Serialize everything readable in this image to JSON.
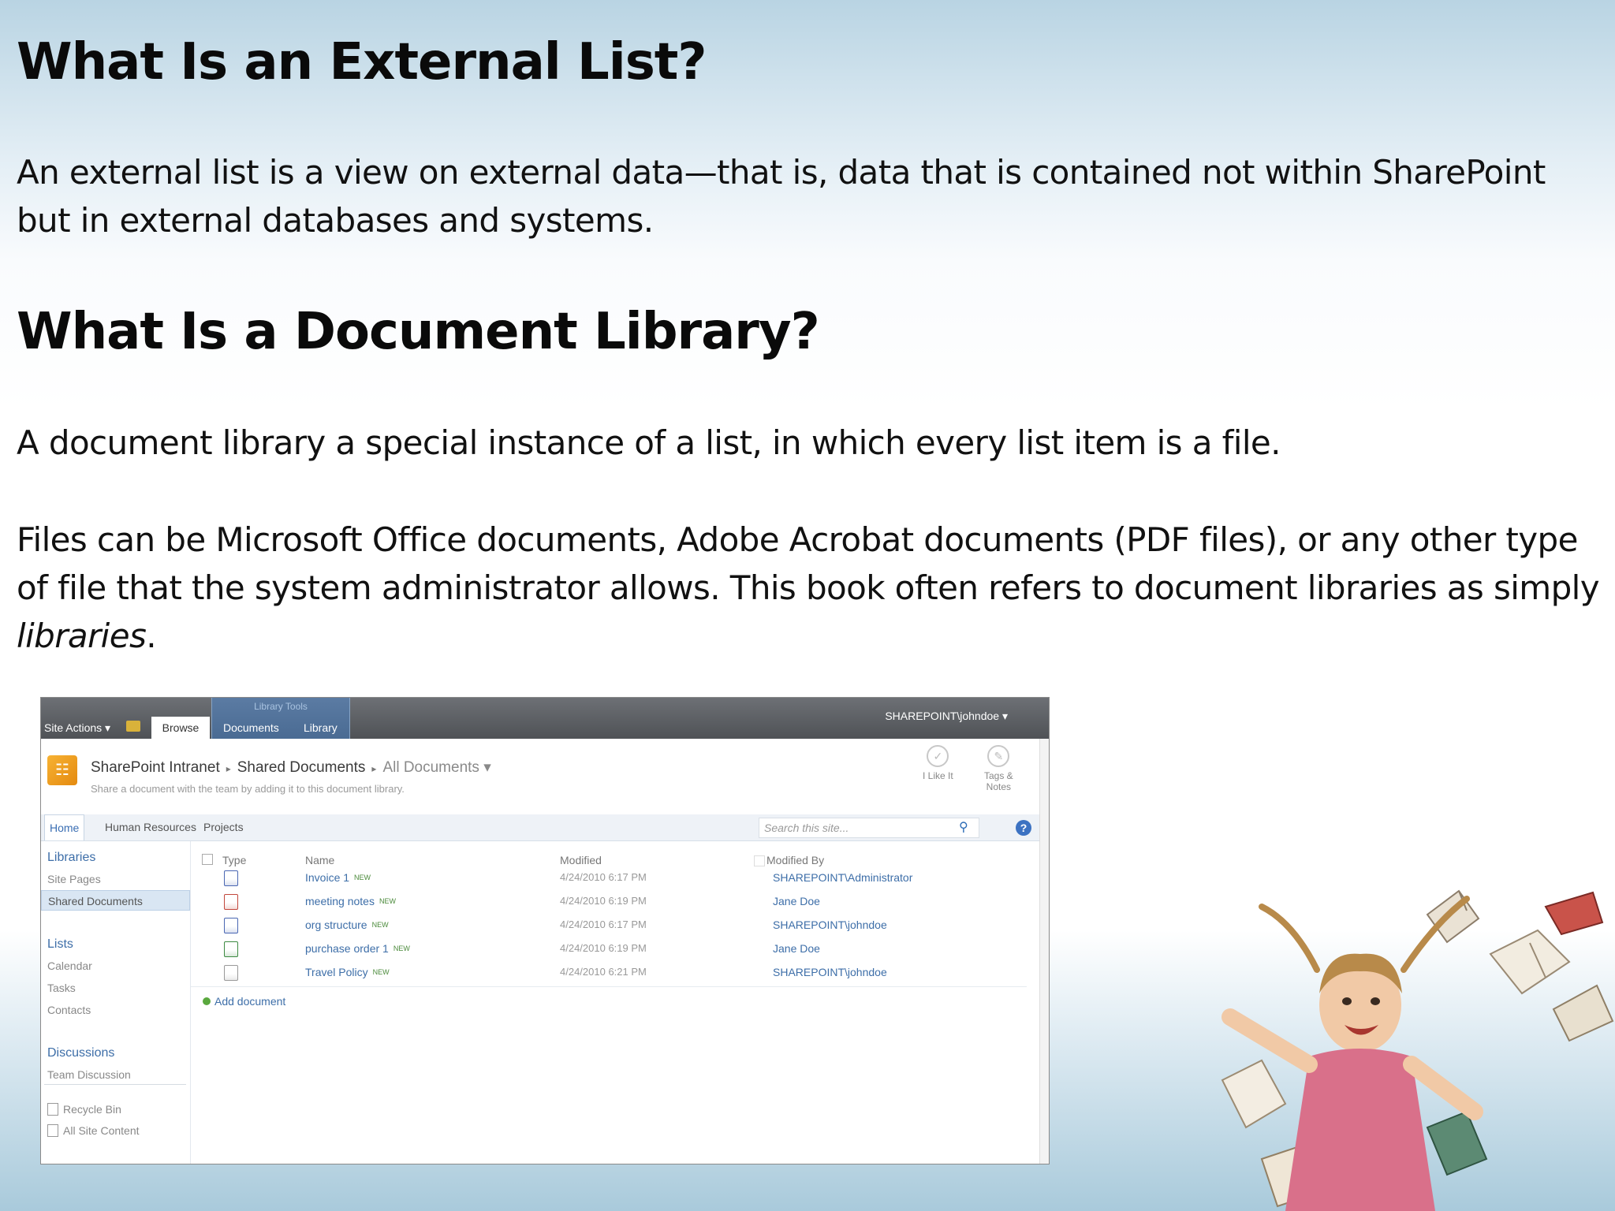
{
  "slide": {
    "heading1": "What Is an External List?",
    "para1": "An external list is a view on external data—that is, data that is contained not within SharePoint but in external databases and systems.",
    "heading2": "What Is a Document Library?",
    "para2": "A document library a special instance of a list, in which every list item is a file.",
    "para3_start": "Files can be Microsoft Office documents, Adobe Acrobat documents (PDF files), or any other type of file that the system administrator allows. This book often refers to document libraries as simply ",
    "para3_em": "libraries",
    "para3_end": "."
  },
  "sharepoint": {
    "site_actions": "Site Actions ▾",
    "tab_browse": "Browse",
    "library_tools": "Library Tools",
    "tab_documents": "Documents",
    "tab_library": "Library",
    "user": "SHAREPOINT\\johndoe ▾",
    "breadcrumb": [
      "SharePoint Intranet",
      "Shared Documents",
      "All Documents ▾"
    ],
    "description": "Share a document with the team by adding it to this document library.",
    "i_like_it": "I Like It",
    "tags_notes_line1": "Tags &",
    "tags_notes_line2": "Notes",
    "nav": [
      "Home",
      "Human Resources",
      "Projects"
    ],
    "search_placeholder": "Search this site...",
    "left_nav": {
      "libraries": "Libraries",
      "site_pages": "Site Pages",
      "shared_documents": "Shared Documents",
      "lists": "Lists",
      "calendar": "Calendar",
      "tasks": "Tasks",
      "contacts": "Contacts",
      "discussions": "Discussions",
      "team_discussion": "Team Discussion",
      "recycle_bin": "Recycle Bin",
      "all_site_content": "All Site Content"
    },
    "columns": {
      "type": "Type",
      "name": "Name",
      "modified": "Modified",
      "modified_by": "Modified By"
    },
    "new_badge": "NEW",
    "rows": [
      {
        "name": "Invoice 1",
        "modified": "4/24/2010 6:17 PM",
        "modified_by": "SHAREPOINT\\Administrator",
        "icon_color": "#4a67b3"
      },
      {
        "name": "meeting notes",
        "modified": "4/24/2010 6:19 PM",
        "modified_by": "Jane Doe",
        "icon_color": "#c2473c"
      },
      {
        "name": "org structure",
        "modified": "4/24/2010 6:17 PM",
        "modified_by": "SHAREPOINT\\johndoe",
        "icon_color": "#4a67b3"
      },
      {
        "name": "purchase order 1",
        "modified": "4/24/2010 6:19 PM",
        "modified_by": "Jane Doe",
        "icon_color": "#3d8a42"
      },
      {
        "name": "Travel Policy",
        "modified": "4/24/2010 6:21 PM",
        "modified_by": "SHAREPOINT\\johndoe",
        "icon_color": "#999999"
      }
    ],
    "add_document": "Add document"
  }
}
